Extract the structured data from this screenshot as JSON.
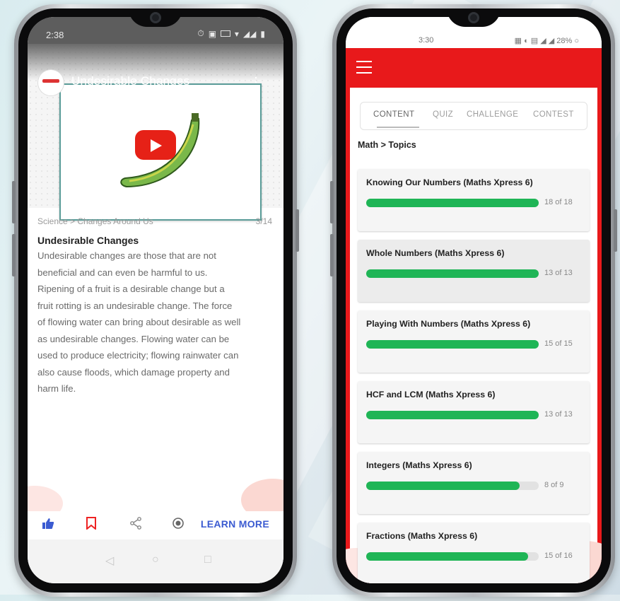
{
  "left": {
    "status_time": "2:38",
    "video_title": "Undesirable Changes",
    "breadcrumb": "Science > Changes Around Us",
    "counter": "3/14",
    "heading": "Undesirable Changes",
    "body_lines": [
      "Undesirable changes are those that are not",
      "beneficial and can even be harmful to us.",
      "Ripening of a fruit is a desirable change but a",
      "fruit rotting is an undesirable change. The force",
      "of flowing water can bring about desirable as well",
      "as undesirable changes. Flowing water can be",
      "used to produce electricity; flowing rainwater can",
      "also cause floods, which damage property and",
      "harm life."
    ],
    "learn_more": "LEARN MORE",
    "icons": [
      "thumbs-up-icon",
      "bookmark-icon",
      "share-icon",
      "record-icon"
    ],
    "accent": "#3b5bd1"
  },
  "right": {
    "status_time": "3:30",
    "status_battery": "28%",
    "tabs": [
      "CONTENT",
      "QUIZ",
      "CHALLENGE",
      "CONTEST"
    ],
    "active_tab": "CONTENT",
    "path": "Math > Topics",
    "topics": [
      {
        "title": "Knowing Our Numbers (Maths Xpress 6)",
        "label": "18 of 18",
        "done": 18,
        "total": 18
      },
      {
        "title": "Whole Numbers (Maths Xpress 6)",
        "label": "13 of 13",
        "done": 13,
        "total": 13
      },
      {
        "title": "Playing With Numbers (Maths Xpress 6)",
        "label": "15 of 15",
        "done": 15,
        "total": 15
      },
      {
        "title": "HCF and LCM (Maths Xpress 6)",
        "label": "13 of 13",
        "done": 13,
        "total": 13
      },
      {
        "title": "Integers (Maths Xpress 6)",
        "label": "8 of 9",
        "done": 8,
        "total": 9
      },
      {
        "title": "Fractions (Maths Xpress 6)",
        "label": "15 of 16",
        "done": 15,
        "total": 16
      }
    ],
    "brand_color": "#e8191b",
    "progress_color": "#1fb556"
  }
}
